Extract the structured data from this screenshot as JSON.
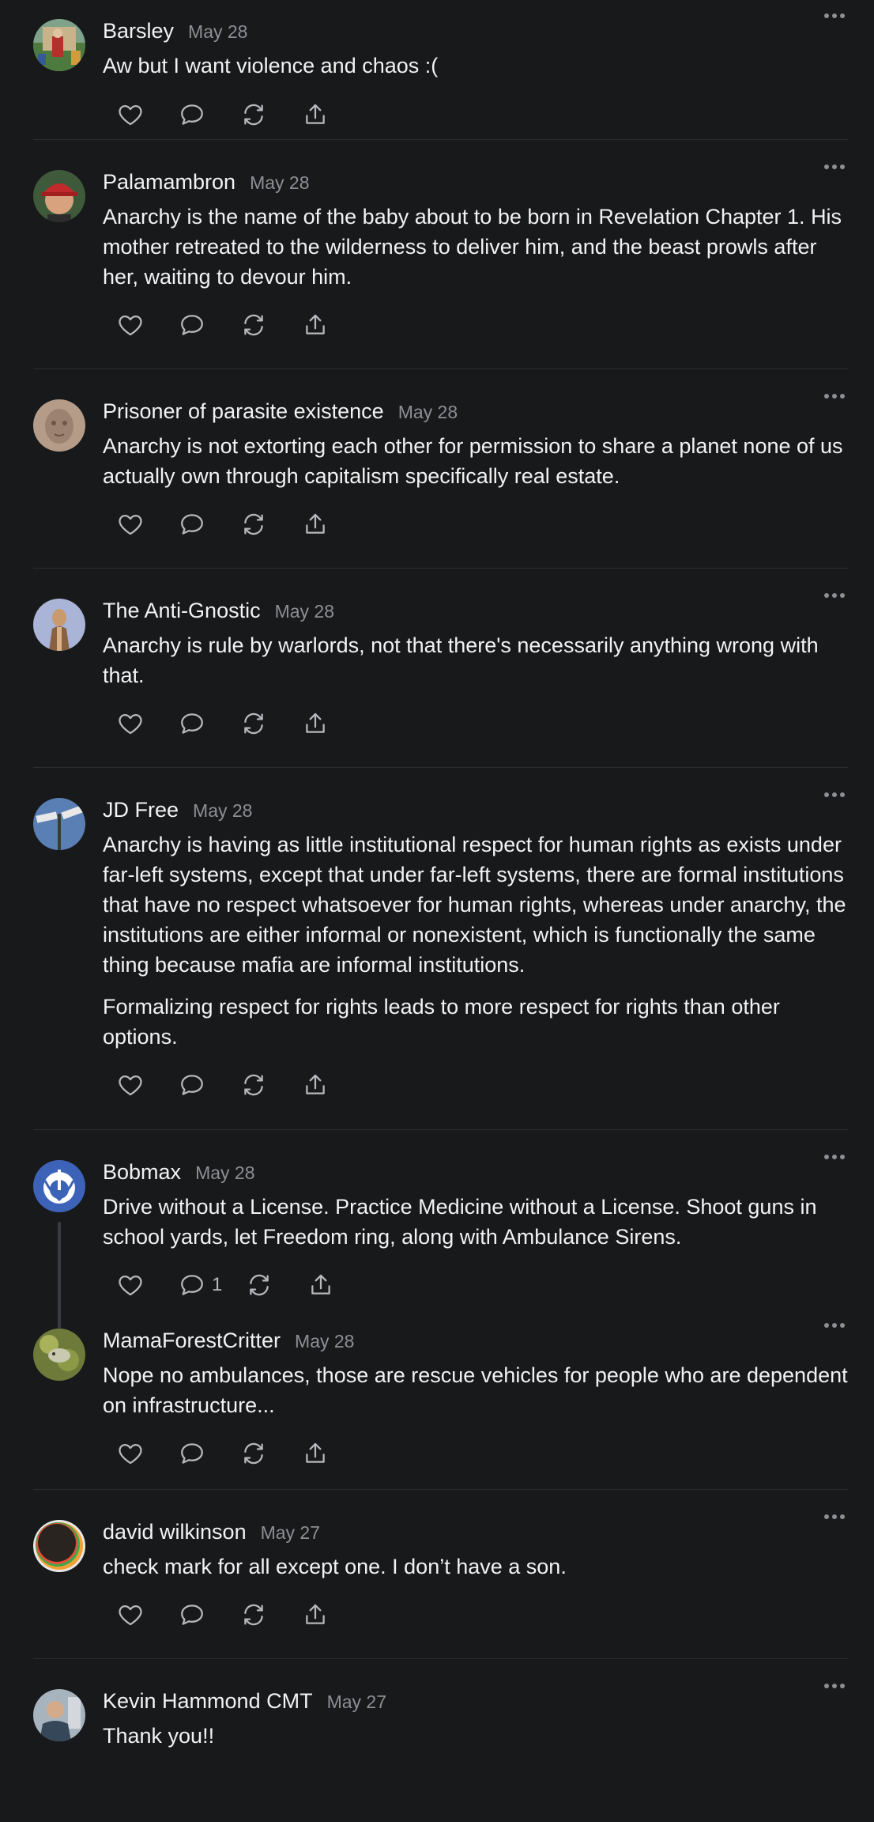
{
  "comments": [
    {
      "author": "Barsley",
      "date": "May 28",
      "paragraphs": [
        "Aw but I want violence and chaos :("
      ],
      "reply_count": ""
    },
    {
      "author": "Palamambron",
      "date": "May 28",
      "paragraphs": [
        "Anarchy is the name of the baby about to be born in Revelation Chapter 1. His mother retreated to the wilderness to deliver him, and the beast prowls after her, waiting to devour him."
      ],
      "reply_count": ""
    },
    {
      "author": "Prisoner of parasite existence",
      "date": "May 28",
      "paragraphs": [
        "Anarchy is not extorting each other for permission to share a planet none of us actually own through capitalism specifically real estate."
      ],
      "reply_count": ""
    },
    {
      "author": "The Anti-Gnostic",
      "date": "May 28",
      "paragraphs": [
        "Anarchy is rule by warlords, not that there's necessarily anything wrong with that."
      ],
      "reply_count": ""
    },
    {
      "author": "JD Free",
      "date": "May 28",
      "paragraphs": [
        "Anarchy is having as little institutional respect for human rights as exists under far-left systems, except that under far-left systems, there are formal institutions that have no respect whatsoever for human rights, whereas under anarchy, the institutions are either informal or nonexistent, which is functionally the same thing because mafia are informal institutions.",
        "Formalizing respect for rights leads to more respect for rights than other options."
      ],
      "reply_count": ""
    },
    {
      "author": "Bobmax",
      "date": "May 28",
      "paragraphs": [
        "Drive without a License. Practice Medicine without a License. Shoot guns in school yards, let Freedom ring, along with Ambulance Sirens."
      ],
      "reply_count": "1"
    },
    {
      "author": "MamaForestCritter",
      "date": "May 28",
      "paragraphs": [
        "Nope no ambulances, those are rescue vehicles for people who are dependent on infrastructure..."
      ],
      "reply_count": ""
    },
    {
      "author": "david wilkinson",
      "date": "May 27",
      "paragraphs": [
        "check mark for all except one. I don’t have a son."
      ],
      "reply_count": ""
    },
    {
      "author": "Kevin Hammond CMT",
      "date": "May 27",
      "paragraphs": [
        "Thank you!!"
      ],
      "reply_count": ""
    }
  ],
  "icons": {
    "like": "heart-icon",
    "reply": "speech-bubble-icon",
    "restack": "restack-icon",
    "share": "share-icon",
    "more": "ellipsis-icon"
  },
  "colors": {
    "background": "#18191b",
    "text": "#f2f2f2",
    "muted": "#8e8f93",
    "divider": "#2c2d30"
  }
}
